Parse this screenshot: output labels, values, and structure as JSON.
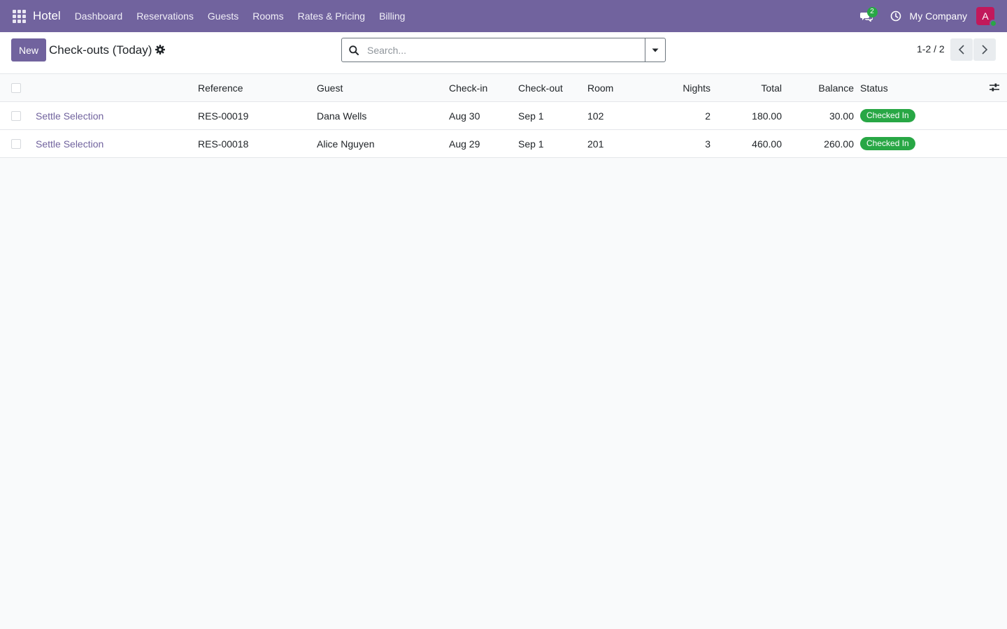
{
  "navbar": {
    "brand": "Hotel",
    "menu": [
      "Dashboard",
      "Reservations",
      "Guests",
      "Rooms",
      "Rates & Pricing",
      "Billing"
    ],
    "chat_count": "2",
    "company": "My Company",
    "avatar_letter": "A",
    "avatar_color": "#c2185b",
    "bar_color": "#71639e"
  },
  "control": {
    "new_label": "New",
    "title": "Check-outs (Today)",
    "search_placeholder": "Search...",
    "pager": "1-2 / 2"
  },
  "table": {
    "headers": {
      "reference": "Reference",
      "guest": "Guest",
      "checkin": "Check-in",
      "checkout": "Check-out",
      "room": "Room",
      "nights": "Nights",
      "total": "Total",
      "balance": "Balance",
      "status": "Status"
    },
    "rows": [
      {
        "action": "Settle Selection",
        "reference": "RES-00019",
        "guest": "Dana Wells",
        "checkin": "Aug 30",
        "checkout": "Sep 1",
        "room": "102",
        "nights": "2",
        "total": "180.00",
        "balance": "30.00",
        "status": "Checked In"
      },
      {
        "action": "Settle Selection",
        "reference": "RES-00018",
        "guest": "Alice Nguyen",
        "checkin": "Aug 29",
        "checkout": "Sep 1",
        "room": "201",
        "nights": "3",
        "total": "460.00",
        "balance": "260.00",
        "status": "Checked In"
      }
    ]
  },
  "colors": {
    "accent": "#71639e",
    "success": "#28a745"
  }
}
